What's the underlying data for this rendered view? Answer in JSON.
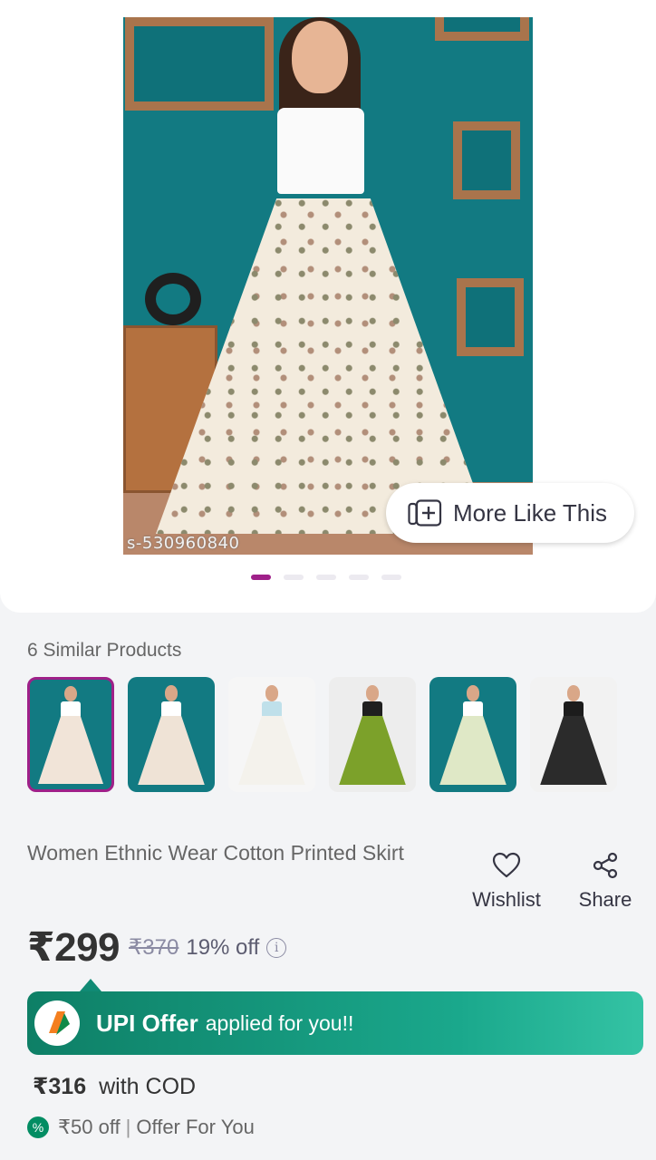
{
  "carousel": {
    "watermark": "s-530960840",
    "more_like_this_label": "More Like This",
    "dots": 5,
    "active_dot": 0,
    "accent_color": "#9f2089"
  },
  "similar": {
    "title": "6 Similar Products",
    "items": [
      {
        "name": "similar-product-1",
        "bg": "#127a82",
        "skirt": "#f1e4d8",
        "top": "#ffffff",
        "selected": true
      },
      {
        "name": "similar-product-2",
        "bg": "#127a82",
        "skirt": "#efe3d6",
        "top": "#ffffff",
        "selected": false
      },
      {
        "name": "similar-product-3",
        "bg": "#f6f6f6",
        "skirt": "#f4f2ec",
        "top": "#bfe0ea",
        "selected": false
      },
      {
        "name": "similar-product-4",
        "bg": "#ededed",
        "skirt": "#7ca12a",
        "top": "#1f1f1f",
        "selected": false
      },
      {
        "name": "similar-product-5",
        "bg": "#127a82",
        "skirt": "#dfe8c6",
        "top": "#ffffff",
        "selected": false
      },
      {
        "name": "similar-product-6",
        "bg": "#f2f2f2",
        "skirt": "#2b2b2b",
        "top": "#1c1c1c",
        "selected": false
      }
    ]
  },
  "product": {
    "title": "Women Ethnic Wear Cotton Printed Skirt",
    "wishlist_label": "Wishlist",
    "share_label": "Share",
    "price": "₹299",
    "mrp": "₹370",
    "discount": "19% off"
  },
  "upi": {
    "main": "UPI Offer",
    "sub": "applied for you!!",
    "color": "#108a74"
  },
  "cod": {
    "price": "₹316",
    "label": "with COD"
  },
  "offer": {
    "amount": "₹50 off",
    "separator": "|",
    "label": "Offer For You"
  }
}
